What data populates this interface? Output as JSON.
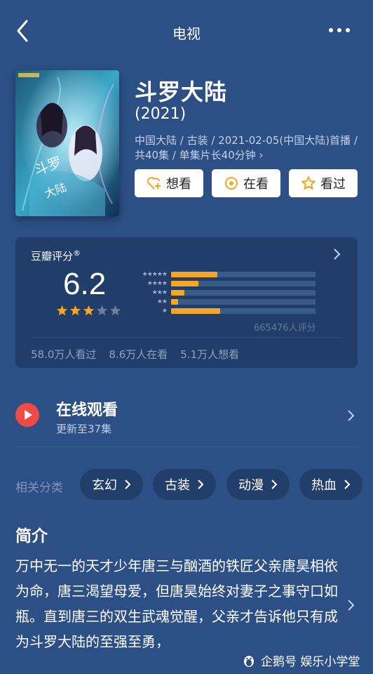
{
  "header": {
    "title": "电视"
  },
  "movie": {
    "title": "斗罗大陆",
    "year": "(2021)",
    "meta": "中国大陆 / 古装 / 2021-02-05(中国大陆)首播 / 共40集 / 单集片长40分钟 ›"
  },
  "actions": {
    "want": "想看",
    "watching": "在看",
    "watched": "看过"
  },
  "rating": {
    "label": "豆瓣评分",
    "label_mark": "®",
    "score": "6.2",
    "stars": 3,
    "count_text": "665476人评分",
    "distribution": [
      0.32,
      0.19,
      0.09,
      0.05,
      0.34
    ],
    "star_row_labels": [
      "★★★★★",
      "★★★★",
      "★★★",
      "★★",
      "★"
    ],
    "stats": [
      "58.0万人看过",
      "8.6万人在看",
      "5.1万人想看"
    ]
  },
  "online": {
    "title": "在线观看",
    "subtitle": "更新至37集"
  },
  "categories": {
    "label": "相关分类",
    "items": [
      "玄幻",
      "古装",
      "动漫",
      "热血"
    ]
  },
  "intro": {
    "heading": "简介",
    "text": "万中无一的天才少年唐三与酗酒的铁匠父亲唐昊相依为命，唐三渴望母爱，但唐昊始终对妻子之事守口如瓶。直到唐三的双生武魂觉醒，父亲才告诉他只有成为斗罗大陆的至强至勇，"
  },
  "watermark": "企鹅号 娱乐小学堂",
  "colors": {
    "background": "#2c4f86",
    "card": "#213e6b",
    "accent": "#f5a623",
    "play": "#f04a47"
  },
  "icons": [
    "back-arrow-icon",
    "more-icon",
    "heart-plus-icon",
    "circle-dot-icon",
    "star-outline-icon",
    "chevron-right-icon",
    "play-icon",
    "penguin-icon"
  ]
}
